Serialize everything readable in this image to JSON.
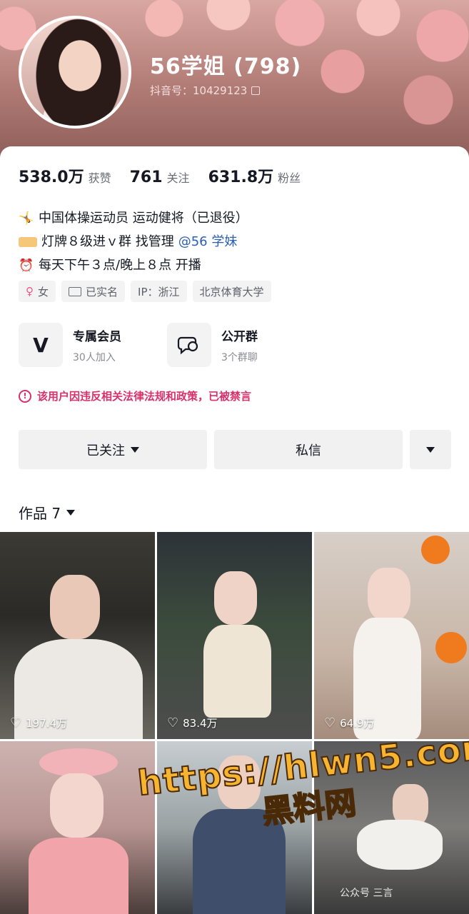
{
  "profile": {
    "nickname": "56学姐 (798)",
    "douyin_id": "抖音号：10429123"
  },
  "stats": [
    {
      "value": "538.0万",
      "label": "获赞"
    },
    {
      "value": "761",
      "label": "关注"
    },
    {
      "value": "631.8万",
      "label": "粉丝"
    }
  ],
  "bio": {
    "line1": "中国体操运动员 运动健将（已退役）",
    "line2_text": "灯牌８级进ｖ群 找管理",
    "line2_mention": "@56 学妹",
    "line3": "每天下午３点/晚上８点 开播",
    "icons": [
      "gymnast-icon",
      "ticket-icon",
      "alarm-clock-icon"
    ]
  },
  "tags": {
    "gender": "女",
    "verified": "已实名",
    "ip": "IP：浙江",
    "school": "北京体育大学"
  },
  "features": {
    "member_title": "专属会员",
    "member_sub": "30人加入",
    "group_title": "公开群",
    "group_sub": "3个群聊"
  },
  "ban_notice": "该用户因违反相关法律法规和政策，已被禁言",
  "actions": {
    "follow": "已关注",
    "message": "私信"
  },
  "works": {
    "title": "作品 7",
    "items": [
      {
        "likes": "197.4万"
      },
      {
        "likes": "83.4万"
      },
      {
        "likes": "64.9万"
      }
    ]
  },
  "watermark": {
    "url": "https://hlwn5.com",
    "site": "黑料网",
    "account": "公众号 三言"
  },
  "colors": {
    "ban_red": "#d8306a",
    "mention_blue": "#2b5fb3"
  }
}
